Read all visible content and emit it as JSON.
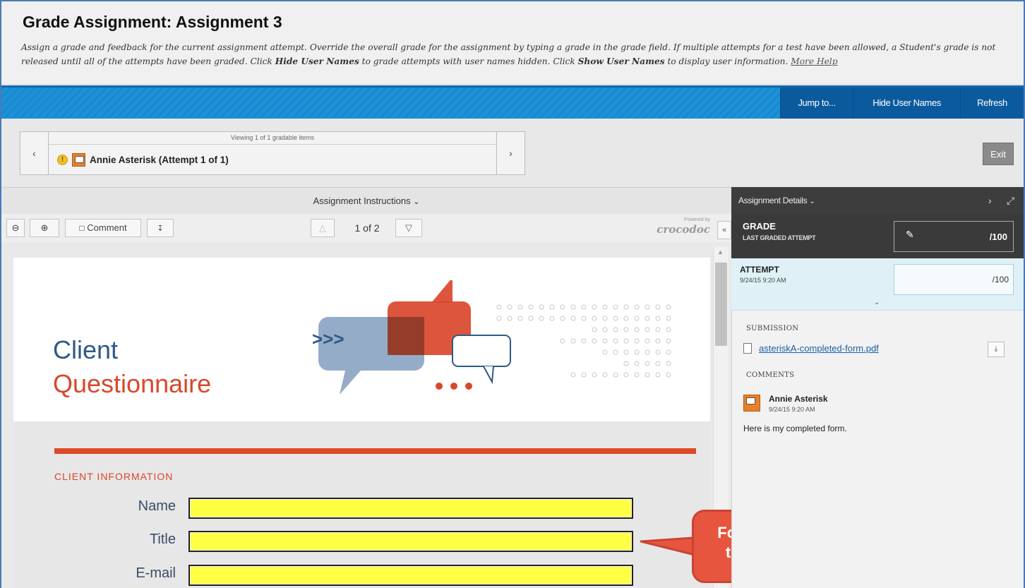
{
  "header": {
    "title": "Grade Assignment: Assignment 3",
    "desc_part1": "Assign a grade and feedback for the current assignment attempt. Override the overall grade for the assignment by typing a grade in the grade field. If multiple attempts for a test have been allowed, a Student's grade is not released until all of the attempts have been graded. Click ",
    "desc_hide": "Hide User Names",
    "desc_part2": " to grade attempts with user names hidden. Click ",
    "desc_show": "Show User Names",
    "desc_part3": " to display user information. ",
    "more_help": "More Help"
  },
  "actionbar": {
    "jump": "Jump to...",
    "hide_user_names": "Hide User Names",
    "refresh": "Refresh"
  },
  "navigator": {
    "viewing": "Viewing 1 of 1 gradable items",
    "student": "Annie Asterisk (Attempt 1 of 1)",
    "prev_icon": "chevron-left-icon",
    "next_icon": "chevron-right-icon",
    "exit": "Exit"
  },
  "viewer": {
    "instructions": "Assignment Instructions",
    "comment": "Comment",
    "page_indicator": "1 of 2",
    "powered_by": "Powered by",
    "crocodoc": "crocodoc"
  },
  "document": {
    "title_line1": "Client",
    "title_line2": "Questionnaire",
    "arrows": ">>>",
    "section": "CLIENT INFORMATION",
    "fields": [
      {
        "label": "Name"
      },
      {
        "label": "Title"
      },
      {
        "label": "E-mail"
      }
    ],
    "field_fill_color": "#ffff44",
    "accent_color": "#dc4a2a"
  },
  "callout": {
    "line1": "Form appears",
    "line2": "to be blank."
  },
  "panel": {
    "details": "Assignment Details",
    "grade_label": "GRADE",
    "grade_sub": "LAST GRADED ATTEMPT",
    "grade_value": "/100",
    "attempt_label": "ATTEMPT",
    "attempt_date": "9/24/15 9:20 AM",
    "attempt_value": "/100",
    "submission_head": "SUBMISSION",
    "file_name": "asteriskA-completed-form.pdf",
    "comments_head": "COMMENTS",
    "comment_author": "Annie Asterisk",
    "comment_date": "9/24/15 9:20 AM",
    "comment_text": "Here is my completed form."
  }
}
